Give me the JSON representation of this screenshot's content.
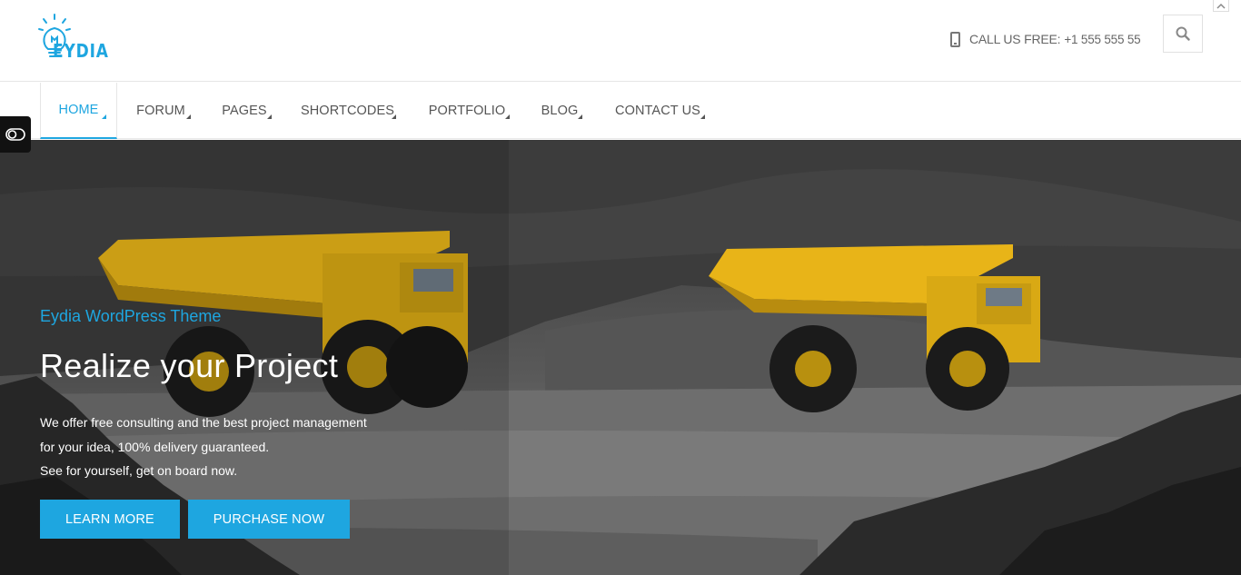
{
  "header": {
    "logo_text": "EYDIA",
    "phone_label": "CALL US FREE:",
    "phone_number": "+1 555 555 55",
    "icons": {
      "logo": "lightbulb-icon",
      "phone": "phone-icon",
      "search": "search-icon",
      "scroll_top": "chevron-up-icon"
    }
  },
  "nav": {
    "items": [
      {
        "label": "HOME",
        "active": true
      },
      {
        "label": "FORUM",
        "active": false
      },
      {
        "label": "PAGES",
        "active": false
      },
      {
        "label": "SHORTCODES",
        "active": false
      },
      {
        "label": "PORTFOLIO",
        "active": false
      },
      {
        "label": "BLOG",
        "active": false
      },
      {
        "label": "CONTACT US",
        "active": false
      }
    ]
  },
  "hero": {
    "subtitle": "Eydia WordPress Theme",
    "title": "Realize your Project",
    "lines": [
      "We offer free consulting and the best project management",
      "for your idea, 100% delivery guaranteed.",
      "See for yourself, get on board now."
    ],
    "buttons": {
      "learn_more": "LEARN MORE",
      "purchase_now": "PURCHASE NOW"
    }
  },
  "colors": {
    "accent": "#1ea6e0",
    "truck": "#e8b418",
    "text": "#555555"
  }
}
